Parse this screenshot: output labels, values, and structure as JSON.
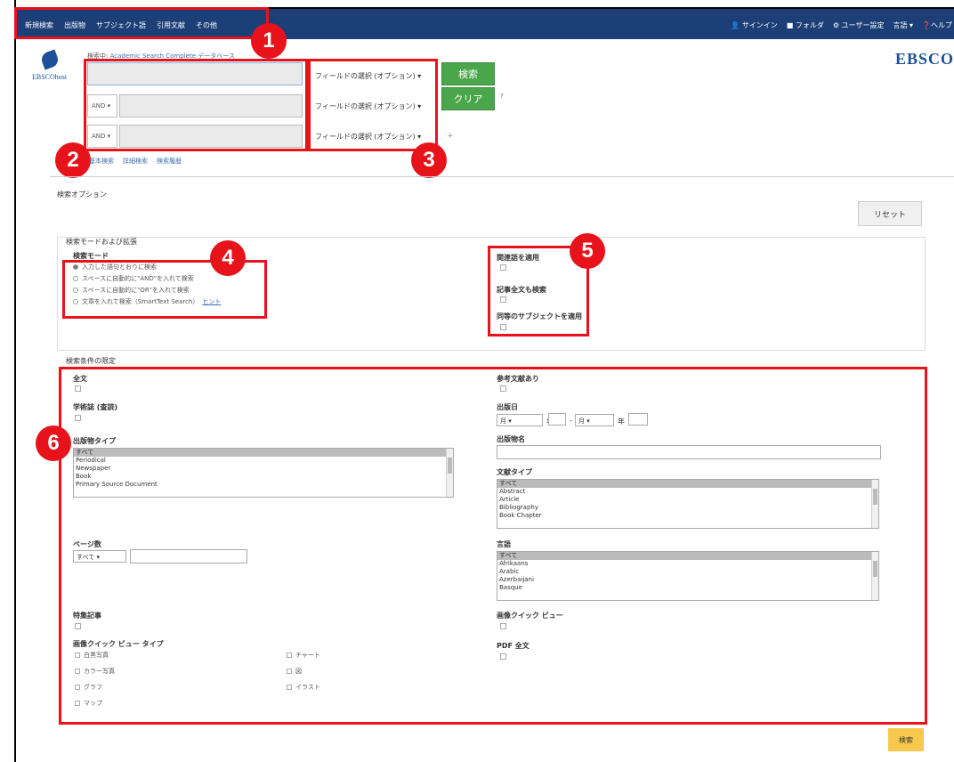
{
  "nav": {
    "items": [
      "新規検索",
      "出版物",
      "サブジェクト語",
      "引用文献",
      "その他"
    ],
    "right_items": [
      "サインイン",
      "フォルダ",
      "ユーザー設定",
      "言語",
      "ヘルプ"
    ]
  },
  "header": {
    "logo_text": "EBSCOhost",
    "brand": "EBSCO",
    "searching_label": "検索中:",
    "database": "Academic Search Complete",
    "choose_db": "データベース"
  },
  "search": {
    "bool_ops": [
      "AND",
      "AND"
    ],
    "field_select_label": "フィールドの選択 (オプション)",
    "search_button": "検索",
    "clear_button": "クリア",
    "help_q": "?",
    "add_row": "+",
    "links": [
      "基本検索",
      "詳細検索",
      "検索履歴"
    ]
  },
  "options": {
    "title": "検索オプション",
    "reset": "リセット",
    "mode_section": "検索モードおよび拡張",
    "mode_label": "検索モード",
    "modes": [
      "入力した語句とおりに検索",
      "スペースに自動的に\"AND\"を入れて検索",
      "スペースに自動的に\"OR\"を入れて検索",
      "文章を入れて検索（SmartText Search）"
    ],
    "hint": "ヒント",
    "expanders": [
      "関連語を適用",
      "記事全文も検索",
      "同等のサブジェクトを適用"
    ],
    "limit_section": "検索条件の限定",
    "fulltext": "全文",
    "scholarly": "学術誌 (査読)",
    "pubtype_label": "出版物タイプ",
    "pubtypes": [
      "すべて",
      "Periodical",
      "Newspaper",
      "Book",
      "Primary Source Document"
    ],
    "pages_label": "ページ数",
    "pages_value": "すべて",
    "cover_story": "特集記事",
    "image_qv_type": "画像クイック ビュー タイプ",
    "image_types_col1": [
      "白黒写真",
      "カラー写真",
      "グラフ",
      "マップ"
    ],
    "image_types_col2": [
      "チャート",
      "図",
      "イラスト"
    ],
    "references": "参考文献あり",
    "pubdate_label": "出版日",
    "month": "月",
    "year": "年",
    "pubname_label": "出版物名",
    "doctype_label": "文献タイプ",
    "doctypes": [
      "すべて",
      "Abstract",
      "Article",
      "Bibliography",
      "Book Chapter"
    ],
    "lang_label": "言語",
    "langs": [
      "すべて",
      "Afrikaans",
      "Arabic",
      "Azerbaijani",
      "Basque"
    ],
    "image_qv": "画像クイック ビュー",
    "pdf_fulltext": "PDF 全文",
    "search_bottom": "検索"
  },
  "badges": [
    "1",
    "2",
    "3",
    "4",
    "5",
    "6"
  ],
  "colors": {
    "topbar": "#1d3f77",
    "highlight": "#e8121b",
    "green": "#4aa64b",
    "yellow": "#f6c84b"
  }
}
